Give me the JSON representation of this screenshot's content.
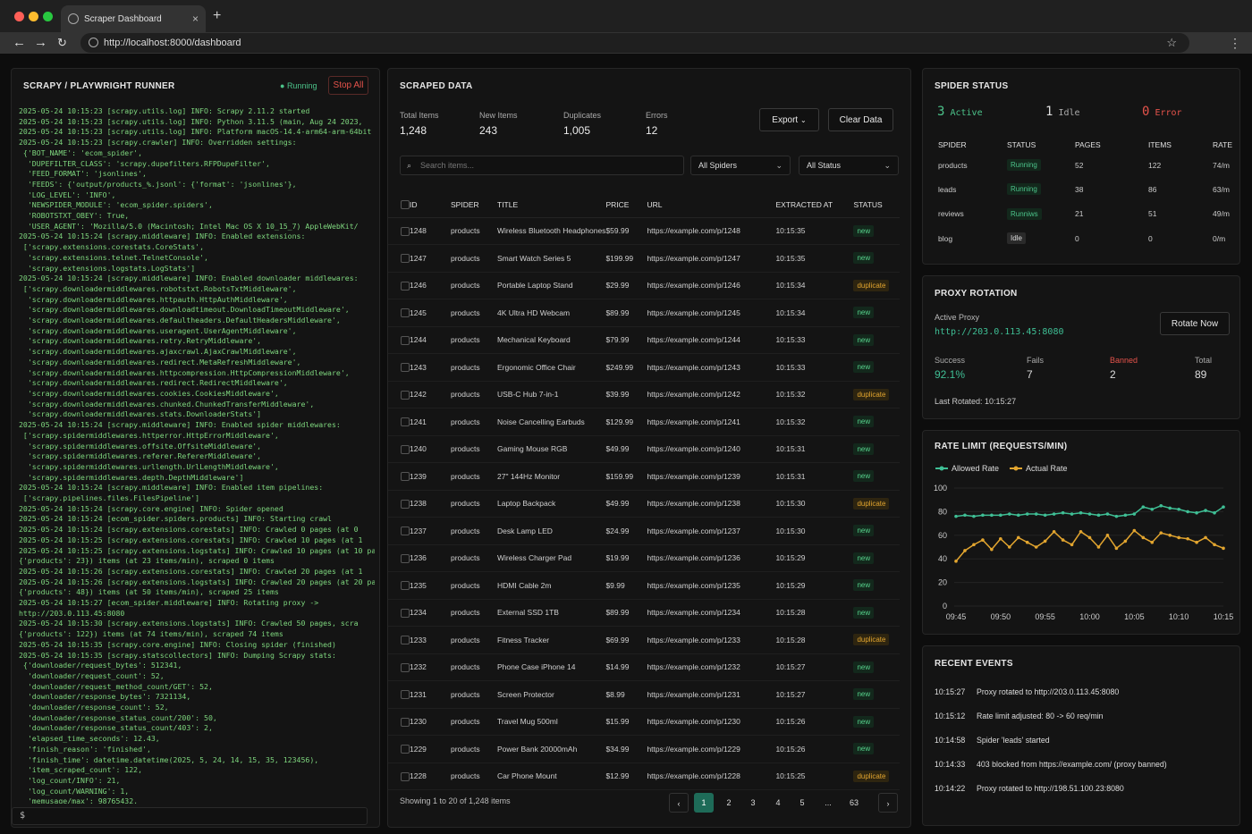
{
  "browser": {
    "tab_title": "Scraper Dashboard",
    "url": "http://localhost:8000/dashboard"
  },
  "runner": {
    "title": "SCRAPY / PLAYWRIGHT RUNNER",
    "status": "Running",
    "stop_label": "Stop All",
    "prompt": "$",
    "log": "2025-05-24 10:15:23 [scrapy.utils.log] INFO: Scrapy 2.11.2 started\n2025-05-24 10:15:23 [scrapy.utils.log] INFO: Python 3.11.5 (main, Aug 24 2023,\n2025-05-24 10:15:23 [scrapy.utils.log] INFO: Platform macOS-14.4-arm64-arm-64bit\n2025-05-24 10:15:23 [scrapy.crawler] INFO: Overridden settings:\n {'BOT_NAME': 'ecom_spider',\n  'DUPEFILTER_CLASS': 'scrapy.dupefilters.RFPDupeFilter',\n  'FEED_FORMAT': 'jsonlines',\n  'FEEDS': {'output/products_%.jsonl': {'format': 'jsonlines'},\n  'LOG_LEVEL': 'INFO',\n  'NEWSPIDER_MODULE': 'ecom_spider.spiders',\n  'ROBOTSTXT_OBEY': True,\n  'USER_AGENT': 'Mozilla/5.0 (Macintosh; Intel Mac OS X 10_15_7) AppleWebKit/\n2025-05-24 10:15:24 [scrapy.middleware] INFO: Enabled extensions:\n ['scrapy.extensions.corestats.CoreStats',\n  'scrapy.extensions.telnet.TelnetConsole',\n  'scrapy.extensions.logstats.LogStats']\n2025-05-24 10:15:24 [scrapy.middleware] INFO: Enabled downloader middlewares:\n ['scrapy.downloadermiddlewares.robotstxt.RobotsTxtMiddleware',\n  'scrapy.downloadermiddlewares.httpauth.HttpAuthMiddleware',\n  'scrapy.downloadermiddlewares.downloadtimeout.DownloadTimeoutMiddleware',\n  'scrapy.downloadermiddlewares.defaultheaders.DefaultHeadersMiddleware',\n  'scrapy.downloadermiddlewares.useragent.UserAgentMiddleware',\n  'scrapy.downloadermiddlewares.retry.RetryMiddleware',\n  'scrapy.downloadermiddlewares.ajaxcrawl.AjaxCrawlMiddleware',\n  'scrapy.downloadermiddlewares.redirect.MetaRefreshMiddleware',\n  'scrapy.downloadermiddlewares.httpcompression.HttpCompressionMiddleware',\n  'scrapy.downloadermiddlewares.redirect.RedirectMiddleware',\n  'scrapy.downloadermiddlewares.cookies.CookiesMiddleware',\n  'scrapy.downloadermiddlewares.chunked.ChunkedTransferMiddleware',\n  'scrapy.downloadermiddlewares.stats.DownloaderStats']\n2025-05-24 10:15:24 [scrapy.middleware] INFO: Enabled spider middlewares:\n ['scrapy.spidermiddlewares.httperror.HttpErrorMiddleware',\n  'scrapy.spidermiddlewares.offsite.OffsiteMiddleware',\n  'scrapy.spidermiddlewares.referer.RefererMiddleware',\n  'scrapy.spidermiddlewares.urllength.UrlLengthMiddleware',\n  'scrapy.spidermiddlewares.depth.DepthMiddleware']\n2025-05-24 10:15:24 [scrapy.middleware] INFO: Enabled item pipelines:\n ['scrapy.pipelines.files.FilesPipeline']\n2025-05-24 10:15:24 [scrapy.core.engine] INFO: Spider opened\n2025-05-24 10:15:24 [ecom_spider.spiders.products] INFO: Starting crawl\n2025-05-24 10:15:24 [scrapy.extensions.corestats] INFO: Crawled 0 pages (at 0\n2025-05-24 10:15:25 [scrapy.extensions.corestats] INFO: Crawled 10 pages (at 1\n2025-05-24 10:15:25 [scrapy.extensions.logstats] INFO: Crawled 10 pages (at 10 pages/min), scra\n{'products': 23}) items (at 23 items/min), scraped 0 items\n2025-05-24 10:15:26 [scrapy.extensions.corestats] INFO: Crawled 20 pages (at 1\n2025-05-24 10:15:26 [scrapy.extensions.logstats] INFO: Crawled 20 pages (at 20 pages/min), scra\n{'products': 48}) items (at 50 items/min), scraped 25 items\n2025-05-24 10:15:27 [ecom_spider.middleware] INFO: Rotating proxy ->\nhttp://203.0.113.45:8080\n2025-05-24 10:15:30 [scrapy.extensions.logstats] INFO: Crawled 50 pages, scra\n{'products': 122}) items (at 74 items/min), scraped 74 items\n2025-05-24 10:15:35 [scrapy.core.engine] INFO: Closing spider (finished)\n2025-05-24 10:15:35 [scrapy.statscollectors] INFO: Dumping Scrapy stats:\n {'downloader/request_bytes': 512341,\n  'downloader/request_count': 52,\n  'downloader/request_method_count/GET': 52,\n  'downloader/response_bytes': 7321134,\n  'downloader/response_count': 52,\n  'downloader/response_status_count/200': 50,\n  'downloader/response_status_count/403': 2,\n  'elapsed_time_seconds': 12.43,\n  'finish_reason': 'finished',\n  'finish_time': datetime.datetime(2025, 5, 24, 14, 15, 35, 123456),\n  'item_scraped_count': 122,\n  'log_count/INFO': 21,\n  'log_count/WARNING': 1,\n  'memusage/max': 98765432,"
  },
  "scraped": {
    "title": "SCRAPED DATA",
    "stats": [
      {
        "label": "Total Items",
        "value": "1,248"
      },
      {
        "label": "New Items",
        "value": "243"
      },
      {
        "label": "Duplicates",
        "value": "1,005"
      },
      {
        "label": "Errors",
        "value": "12"
      }
    ],
    "export_label": "Export",
    "clear_label": "Clear Data",
    "search_placeholder": "Search items...",
    "spider_filter": "All Spiders",
    "status_filter": "All Status",
    "columns": [
      "ID",
      "SPIDER",
      "TITLE",
      "PRICE",
      "URL",
      "EXTRACTED AT",
      "STATUS"
    ],
    "rows": [
      [
        "1248",
        "products",
        "Wireless Bluetooth Headphones",
        "$59.99",
        "https://example.com/p/1248",
        "10:15:35",
        "new"
      ],
      [
        "1247",
        "products",
        "Smart Watch Series 5",
        "$199.99",
        "https://example.com/p/1247",
        "10:15:35",
        "new"
      ],
      [
        "1246",
        "products",
        "Portable Laptop Stand",
        "$29.99",
        "https://example.com/p/1246",
        "10:15:34",
        "duplicate"
      ],
      [
        "1245",
        "products",
        "4K Ultra HD Webcam",
        "$89.99",
        "https://example.com/p/1245",
        "10:15:34",
        "new"
      ],
      [
        "1244",
        "products",
        "Mechanical Keyboard",
        "$79.99",
        "https://example.com/p/1244",
        "10:15:33",
        "new"
      ],
      [
        "1243",
        "products",
        "Ergonomic Office Chair",
        "$249.99",
        "https://example.com/p/1243",
        "10:15:33",
        "new"
      ],
      [
        "1242",
        "products",
        "USB-C Hub 7-in-1",
        "$39.99",
        "https://example.com/p/1242",
        "10:15:32",
        "duplicate"
      ],
      [
        "1241",
        "products",
        "Noise Cancelling Earbuds",
        "$129.99",
        "https://example.com/p/1241",
        "10:15:32",
        "new"
      ],
      [
        "1240",
        "products",
        "Gaming Mouse RGB",
        "$49.99",
        "https://example.com/p/1240",
        "10:15:31",
        "new"
      ],
      [
        "1239",
        "products",
        "27\" 144Hz Monitor",
        "$159.99",
        "https://example.com/p/1239",
        "10:15:31",
        "new"
      ],
      [
        "1238",
        "products",
        "Laptop Backpack",
        "$49.99",
        "https://example.com/p/1238",
        "10:15:30",
        "duplicate"
      ],
      [
        "1237",
        "products",
        "Desk Lamp LED",
        "$24.99",
        "https://example.com/p/1237",
        "10:15:30",
        "new"
      ],
      [
        "1236",
        "products",
        "Wireless Charger Pad",
        "$19.99",
        "https://example.com/p/1236",
        "10:15:29",
        "new"
      ],
      [
        "1235",
        "products",
        "HDMI Cable 2m",
        "$9.99",
        "https://example.com/p/1235",
        "10:15:29",
        "new"
      ],
      [
        "1234",
        "products",
        "External SSD 1TB",
        "$89.99",
        "https://example.com/p/1234",
        "10:15:28",
        "new"
      ],
      [
        "1233",
        "products",
        "Fitness Tracker",
        "$69.99",
        "https://example.com/p/1233",
        "10:15:28",
        "duplicate"
      ],
      [
        "1232",
        "products",
        "Phone Case iPhone 14",
        "$14.99",
        "https://example.com/p/1232",
        "10:15:27",
        "new"
      ],
      [
        "1231",
        "products",
        "Screen Protector",
        "$8.99",
        "https://example.com/p/1231",
        "10:15:27",
        "new"
      ],
      [
        "1230",
        "products",
        "Travel Mug 500ml",
        "$15.99",
        "https://example.com/p/1230",
        "10:15:26",
        "new"
      ],
      [
        "1229",
        "products",
        "Power Bank 20000mAh",
        "$34.99",
        "https://example.com/p/1229",
        "10:15:26",
        "new"
      ],
      [
        "1228",
        "products",
        "Car Phone Mount",
        "$12.99",
        "https://example.com/p/1228",
        "10:15:25",
        "duplicate"
      ]
    ],
    "footer": "Showing 1 to 20 of 1,248 items",
    "pages": [
      "‹",
      "1",
      "2",
      "3",
      "4",
      "5",
      "...",
      "63",
      "›"
    ]
  },
  "spiders": {
    "title": "SPIDER STATUS",
    "summary": [
      {
        "count": "3",
        "label": "Active"
      },
      {
        "count": "1",
        "label": "Idle"
      },
      {
        "count": "0",
        "label": "Error"
      }
    ],
    "columns": [
      "SPIDER",
      "STATUS",
      "PAGES",
      "ITEMS",
      "RATE"
    ],
    "rows": [
      [
        "products",
        "Running",
        "52",
        "122",
        "74/m"
      ],
      [
        "leads",
        "Running",
        "38",
        "86",
        "63/m"
      ],
      [
        "reviews",
        "Runniws",
        "21",
        "51",
        "49/m"
      ],
      [
        "blog",
        "Idle",
        "0",
        "0",
        "0/m"
      ]
    ]
  },
  "proxy": {
    "title": "PROXY ROTATION",
    "active_label": "Active Proxy",
    "active_value": "http://203.0.113.45:8080",
    "rotate_label": "Rotate Now",
    "stats": [
      {
        "label": "Success",
        "value": "92.1%"
      },
      {
        "label": "Fails",
        "value": "7"
      },
      {
        "label": "Banned",
        "value": "2"
      },
      {
        "label": "Total",
        "value": "89"
      }
    ],
    "last_rotated": "Last Rotated: 10:15:27"
  },
  "chart_data": {
    "type": "line",
    "title": "RATE LIMIT (REQUESTS/MIN)",
    "x": [
      "09:45",
      "09:46",
      "09:47",
      "09:48",
      "09:49",
      "09:50",
      "09:51",
      "09:52",
      "09:53",
      "09:54",
      "09:55",
      "09:56",
      "09:57",
      "09:58",
      "09:59",
      "10:00",
      "10:01",
      "10:02",
      "10:03",
      "10:04",
      "10:05",
      "10:06",
      "10:07",
      "10:08",
      "10:09",
      "10:10",
      "10:11",
      "10:12",
      "10:13",
      "10:14",
      "10:15"
    ],
    "xticks": [
      "09:45",
      "09:50",
      "09:55",
      "10:00",
      "10:05",
      "10:10",
      "10:15"
    ],
    "ylim": [
      0,
      100
    ],
    "yticks": [
      0,
      20,
      40,
      60,
      80,
      100
    ],
    "series": [
      {
        "name": "Allowed Rate",
        "color": "#3fbf95",
        "values": [
          76,
          77,
          76,
          77,
          77,
          77,
          78,
          77,
          78,
          78,
          77,
          78,
          79,
          78,
          79,
          78,
          77,
          78,
          76,
          77,
          78,
          84,
          82,
          85,
          83,
          82,
          80,
          79,
          81,
          79,
          84
        ]
      },
      {
        "name": "Actual Rate",
        "color": "#e2a52f",
        "values": [
          38,
          47,
          52,
          56,
          48,
          57,
          50,
          58,
          54,
          50,
          55,
          63,
          56,
          52,
          63,
          58,
          50,
          60,
          49,
          55,
          64,
          58,
          54,
          62,
          60,
          58,
          57,
          54,
          58,
          52,
          49
        ]
      }
    ]
  },
  "events": {
    "title": "RECENT EVENTS",
    "items": [
      {
        "time": "10:15:27",
        "text": "Proxy rotated to http://203.0.113.45:8080"
      },
      {
        "time": "10:15:12",
        "text": "Rate limit adjusted: 80 -> 60 req/min"
      },
      {
        "time": "10:14:58",
        "text": "Spider 'leads' started"
      },
      {
        "time": "10:14:33",
        "text": "403 blocked from https://example.com/ (proxy banned)"
      },
      {
        "time": "10:14:22",
        "text": "Proxy rotated to http://198.51.100.23:8080"
      }
    ]
  }
}
